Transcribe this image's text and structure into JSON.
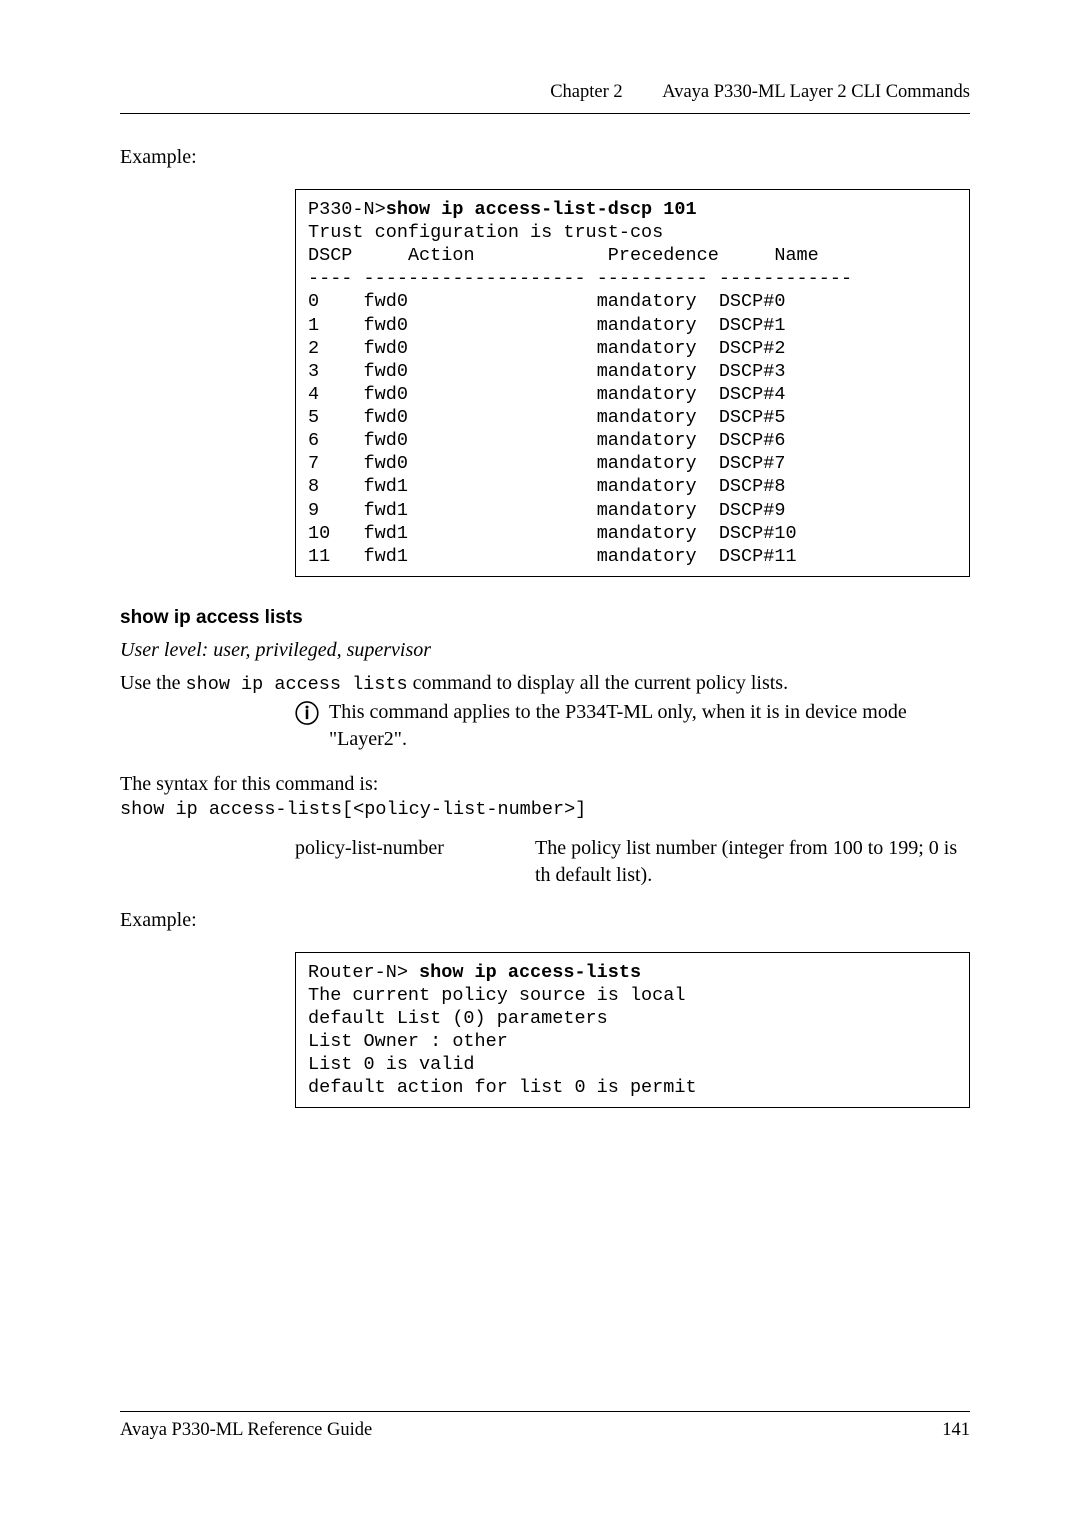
{
  "header": {
    "chapter": "Chapter 2",
    "title": "Avaya P330-ML Layer 2 CLI Commands"
  },
  "example1": {
    "label": "Example:",
    "prompt": "P330-N>",
    "cmd": "show ip access-list-dscp 101",
    "trust_line": "Trust configuration is trust-cos",
    "col_dscp": "DSCP",
    "col_action": "Action",
    "col_precedence": "Precedence",
    "col_name": "Name",
    "sep1": "----",
    "sep2": "--------------------",
    "sep3": "----------",
    "sep4": "------------",
    "rows": [
      {
        "dscp": "0",
        "action": "fwd0",
        "prec": "mandatory",
        "name": "DSCP#0"
      },
      {
        "dscp": "1",
        "action": "fwd0",
        "prec": "mandatory",
        "name": "DSCP#1"
      },
      {
        "dscp": "2",
        "action": "fwd0",
        "prec": "mandatory",
        "name": "DSCP#2"
      },
      {
        "dscp": "3",
        "action": "fwd0",
        "prec": "mandatory",
        "name": "DSCP#3"
      },
      {
        "dscp": "4",
        "action": "fwd0",
        "prec": "mandatory",
        "name": "DSCP#4"
      },
      {
        "dscp": "5",
        "action": "fwd0",
        "prec": "mandatory",
        "name": "DSCP#5"
      },
      {
        "dscp": "6",
        "action": "fwd0",
        "prec": "mandatory",
        "name": "DSCP#6"
      },
      {
        "dscp": "7",
        "action": "fwd0",
        "prec": "mandatory",
        "name": "DSCP#7"
      },
      {
        "dscp": "8",
        "action": "fwd1",
        "prec": "mandatory",
        "name": "DSCP#8"
      },
      {
        "dscp": "9",
        "action": "fwd1",
        "prec": "mandatory",
        "name": "DSCP#9"
      },
      {
        "dscp": "10",
        "action": "fwd1",
        "prec": "mandatory",
        "name": "DSCP#10"
      },
      {
        "dscp": "11",
        "action": "fwd1",
        "prec": "mandatory",
        "name": "DSCP#11"
      }
    ]
  },
  "section2": {
    "title": "show ip access lists",
    "userlevel": "User level: user, privileged, supervisor",
    "use_prefix": "Use the ",
    "use_mono": "show ip access lists",
    "use_suffix": " command to display all the current policy lists.",
    "note": "This command applies to the P334T-ML only, when it is in device mode \"Layer2\".",
    "syntax_label": "The syntax for this command is:",
    "syntax_cmd": "show ip access-lists[<policy-list-number>]",
    "param_name": "policy-list-number",
    "param_desc": "The policy list number (integer from 100 to 199; 0 is th default list).",
    "example_label": "Example:"
  },
  "example2": {
    "prompt": "Router-N> ",
    "cmd": "show ip access-lists",
    "line1": "The current policy source is local",
    "line2": "default List (0) parameters",
    "line3": "List Owner : other",
    "line4": "List 0 is valid",
    "line5": "default action for list 0 is permit"
  },
  "footer": {
    "left": "Avaya P330-ML Reference Guide",
    "right": "141"
  }
}
